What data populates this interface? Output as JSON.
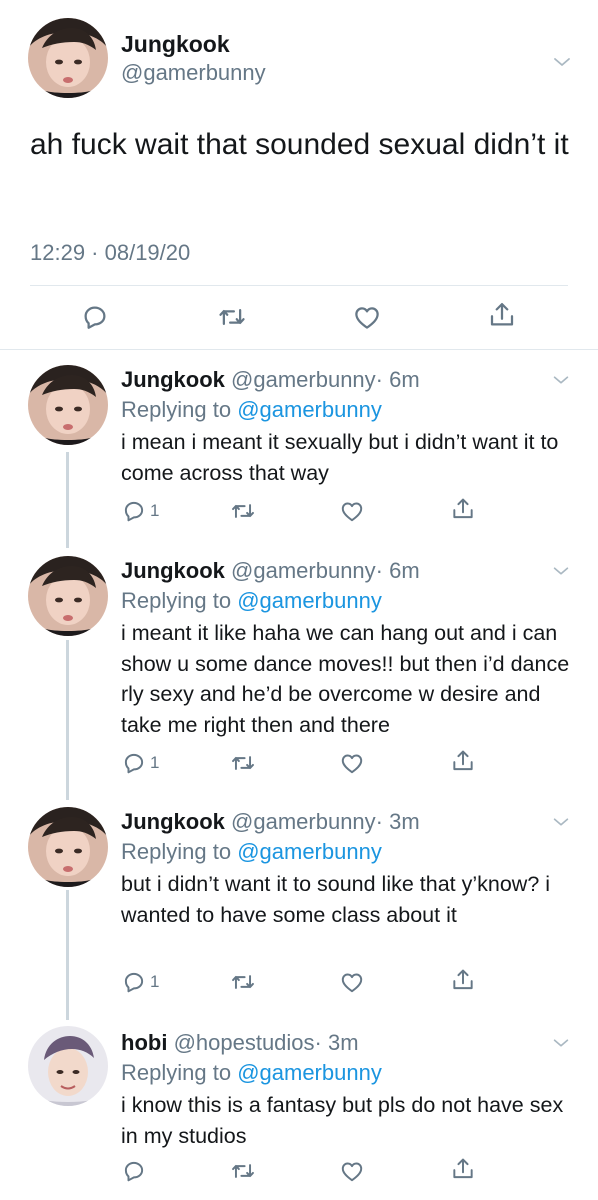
{
  "main_tweet": {
    "display_name": "Jungkook",
    "handle": "@gamerbunny",
    "text": "ah fuck wait that sounded sexual didn’t it",
    "timestamp": "12:29 · 08/19/20",
    "actions": [
      "reply-icon",
      "retweet-icon",
      "like-icon",
      "share-icon"
    ]
  },
  "replies": [
    {
      "display_name": "Jungkook",
      "handle": "@gamerbunny",
      "time": "· 6m",
      "replying_prefix": "Replying to ",
      "replying_to": "@gamerbunny",
      "text": "i mean i meant it sexually but i didn’t want it to come across that way",
      "reply_count": "1"
    },
    {
      "display_name": "Jungkook",
      "handle": "@gamerbunny",
      "time": "· 6m",
      "replying_prefix": "Replying to ",
      "replying_to": "@gamerbunny",
      "text": "i meant it like haha we can hang out and i can show u some dance moves!! but then i’d dance rly sexy and he’d be overcome w desire and take me right then and there",
      "reply_count": "1"
    },
    {
      "display_name": "Jungkook",
      "handle": "@gamerbunny",
      "time": "· 3m",
      "replying_prefix": "Replying to ",
      "replying_to": "@gamerbunny",
      "text": "but i didn’t want it to sound like that y’know? i wanted to have some class about it",
      "reply_count": "1"
    },
    {
      "display_name": "hobi",
      "handle": "@hopestudios",
      "time": "· 3m",
      "replying_prefix": "Replying to ",
      "replying_to": "@gamerbunny",
      "text": "i know this is a fantasy but pls do not have sex in my studios",
      "reply_count": ""
    }
  ],
  "colors": {
    "text": "#14171a",
    "secondary": "#657786",
    "link": "#1b95e0",
    "divider": "#e1e8ed",
    "thread_line": "#ccd6dd"
  }
}
